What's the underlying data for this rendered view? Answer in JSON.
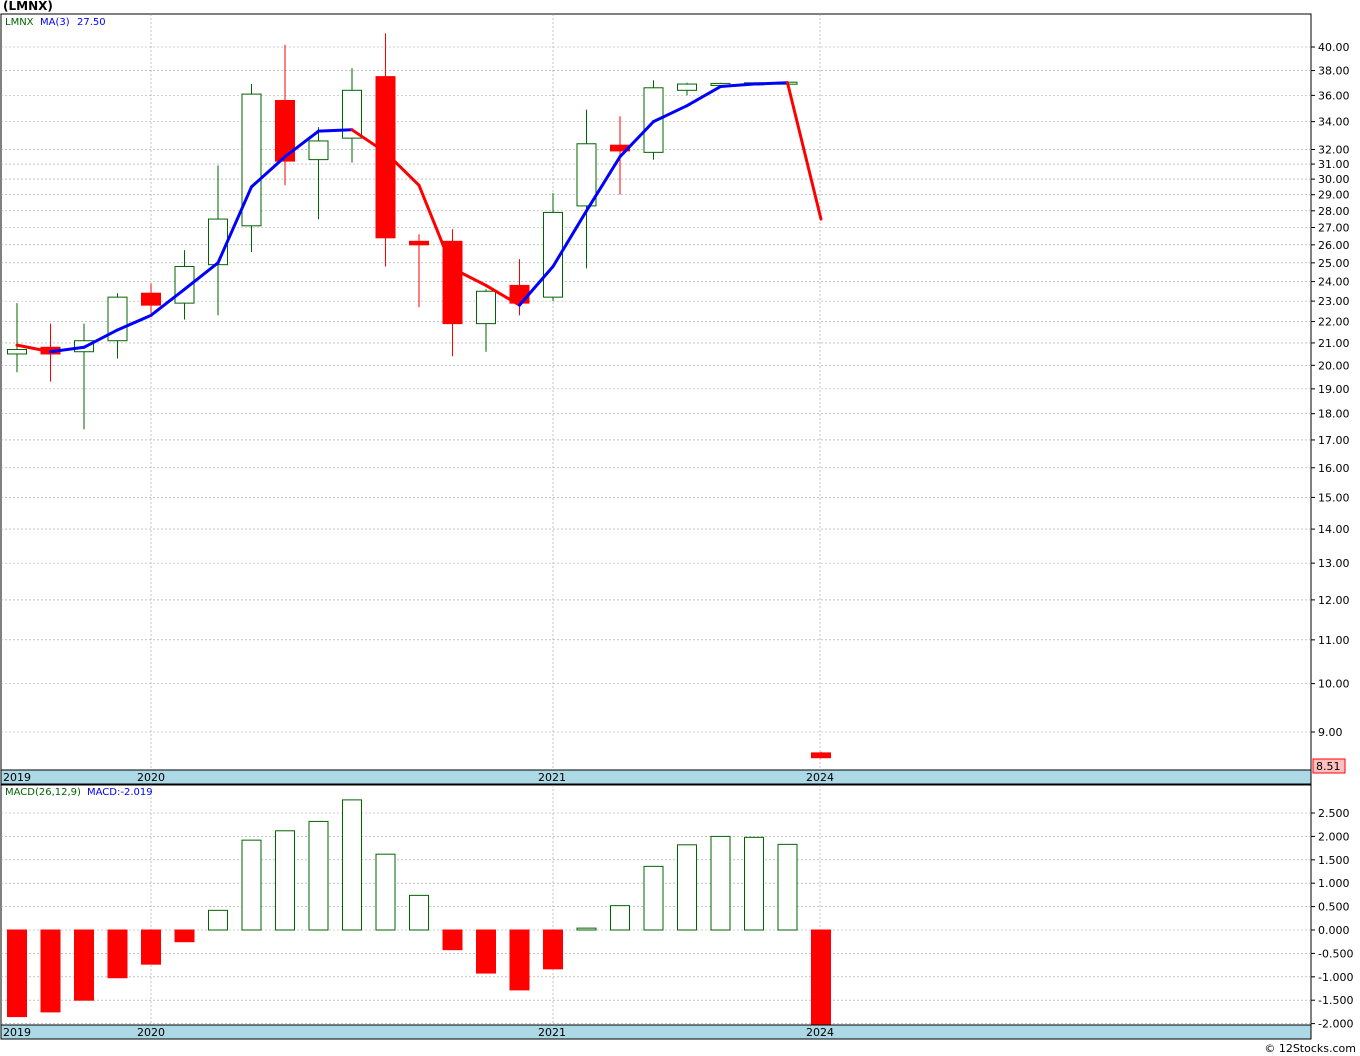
{
  "title": "(LMNX)",
  "credit": "© 12Stocks.com",
  "colors": {
    "up": "#006400",
    "down": "#ff0000",
    "ma_up": "#0000ff",
    "ma_down": "#ff0000",
    "axis_band": "#add8e6",
    "grid": "#a0a0a0",
    "price_tag_bg": "#ffc0c0"
  },
  "chart_data": [
    {
      "type": "candlestick",
      "scale": "log",
      "ticker_label": "LMNX",
      "ma_label": "MA(3)",
      "ma_value_label": "27.50",
      "last_price_label": "8.51",
      "y_ticks": [
        "40.00",
        "38.00",
        "36.00",
        "34.00",
        "32.00",
        "31.00",
        "30.00",
        "29.00",
        "28.00",
        "27.00",
        "26.00",
        "25.00",
        "24.00",
        "23.00",
        "22.00",
        "21.00",
        "20.00",
        "19.00",
        "18.00",
        "17.00",
        "16.00",
        "15.00",
        "14.00",
        "13.00",
        "12.00",
        "11.00",
        "10.00",
        "9.00"
      ],
      "date_labels": [
        "2019",
        "2020",
        "2021",
        "2024"
      ],
      "candles": [
        {
          "o": 20.5,
          "h": 22.9,
          "l": 19.7,
          "c": 20.7
        },
        {
          "o": 20.8,
          "h": 21.9,
          "l": 19.3,
          "c": 20.5
        },
        {
          "o": 20.6,
          "h": 21.9,
          "l": 17.4,
          "c": 21.1
        },
        {
          "o": 21.1,
          "h": 23.4,
          "l": 20.3,
          "c": 23.2
        },
        {
          "o": 23.4,
          "h": 23.9,
          "l": 22.4,
          "c": 22.8
        },
        {
          "o": 22.9,
          "h": 25.7,
          "l": 22.1,
          "c": 24.8
        },
        {
          "o": 24.9,
          "h": 30.9,
          "l": 22.3,
          "c": 27.5
        },
        {
          "o": 27.1,
          "h": 36.9,
          "l": 25.6,
          "c": 36.1
        },
        {
          "o": 35.6,
          "h": 40.2,
          "l": 29.6,
          "c": 31.2
        },
        {
          "o": 31.3,
          "h": 33.6,
          "l": 27.5,
          "c": 32.6
        },
        {
          "o": 32.8,
          "h": 38.2,
          "l": 31.1,
          "c": 36.4
        },
        {
          "o": 37.5,
          "h": 41.2,
          "l": 24.8,
          "c": 26.4
        },
        {
          "o": 26.2,
          "h": 26.6,
          "l": 22.7,
          "c": 26.0
        },
        {
          "o": 26.2,
          "h": 26.9,
          "l": 20.4,
          "c": 21.9
        },
        {
          "o": 21.9,
          "h": 23.6,
          "l": 20.6,
          "c": 23.5
        },
        {
          "o": 23.8,
          "h": 25.2,
          "l": 22.3,
          "c": 22.9
        },
        {
          "o": 23.2,
          "h": 29.1,
          "l": 23.0,
          "c": 27.9
        },
        {
          "o": 28.3,
          "h": 34.9,
          "l": 24.7,
          "c": 32.4
        },
        {
          "o": 32.3,
          "h": 34.4,
          "l": 29.0,
          "c": 31.9
        },
        {
          "o": 31.8,
          "h": 37.2,
          "l": 31.3,
          "c": 36.6
        },
        {
          "o": 36.4,
          "h": 37.0,
          "l": 36.0,
          "c": 36.9
        },
        {
          "o": 36.9,
          "h": 37.0,
          "l": 36.8,
          "c": 36.95
        },
        {
          "o": 36.95,
          "h": 37.0,
          "l": 36.9,
          "c": 37.0
        },
        {
          "o": 37.0,
          "h": 37.1,
          "l": 36.9,
          "c": 37.05
        },
        {
          "o": 8.6,
          "h": 8.62,
          "l": 8.5,
          "c": 8.51
        }
      ],
      "ma": [
        20.9,
        20.6,
        20.8,
        21.6,
        22.3,
        23.6,
        25.0,
        29.5,
        31.5,
        33.3,
        33.4,
        31.8,
        29.6,
        24.7,
        23.8,
        22.8,
        24.8,
        28.0,
        31.5,
        34.0,
        35.2,
        36.7,
        36.9,
        37.0,
        27.5
      ]
    },
    {
      "type": "bar",
      "indicator_label": "MACD(26,12,9)",
      "value_label": "MACD:-2.019",
      "y_ticks": [
        "2.500",
        "2.000",
        "1.500",
        "1.000",
        "0.500",
        "0.000",
        "-0.500",
        "-1.000",
        "-1.500",
        "-2.000"
      ],
      "date_labels": [
        "2019",
        "2020",
        "2021",
        "2024"
      ],
      "values": [
        -1.85,
        -1.75,
        -1.5,
        -1.02,
        -0.73,
        -0.25,
        0.42,
        1.92,
        2.12,
        2.32,
        2.78,
        1.62,
        0.74,
        -0.42,
        -0.92,
        -1.28,
        -0.83,
        0.04,
        0.52,
        1.36,
        1.82,
        2.0,
        1.98,
        1.83,
        -2.019
      ]
    }
  ]
}
